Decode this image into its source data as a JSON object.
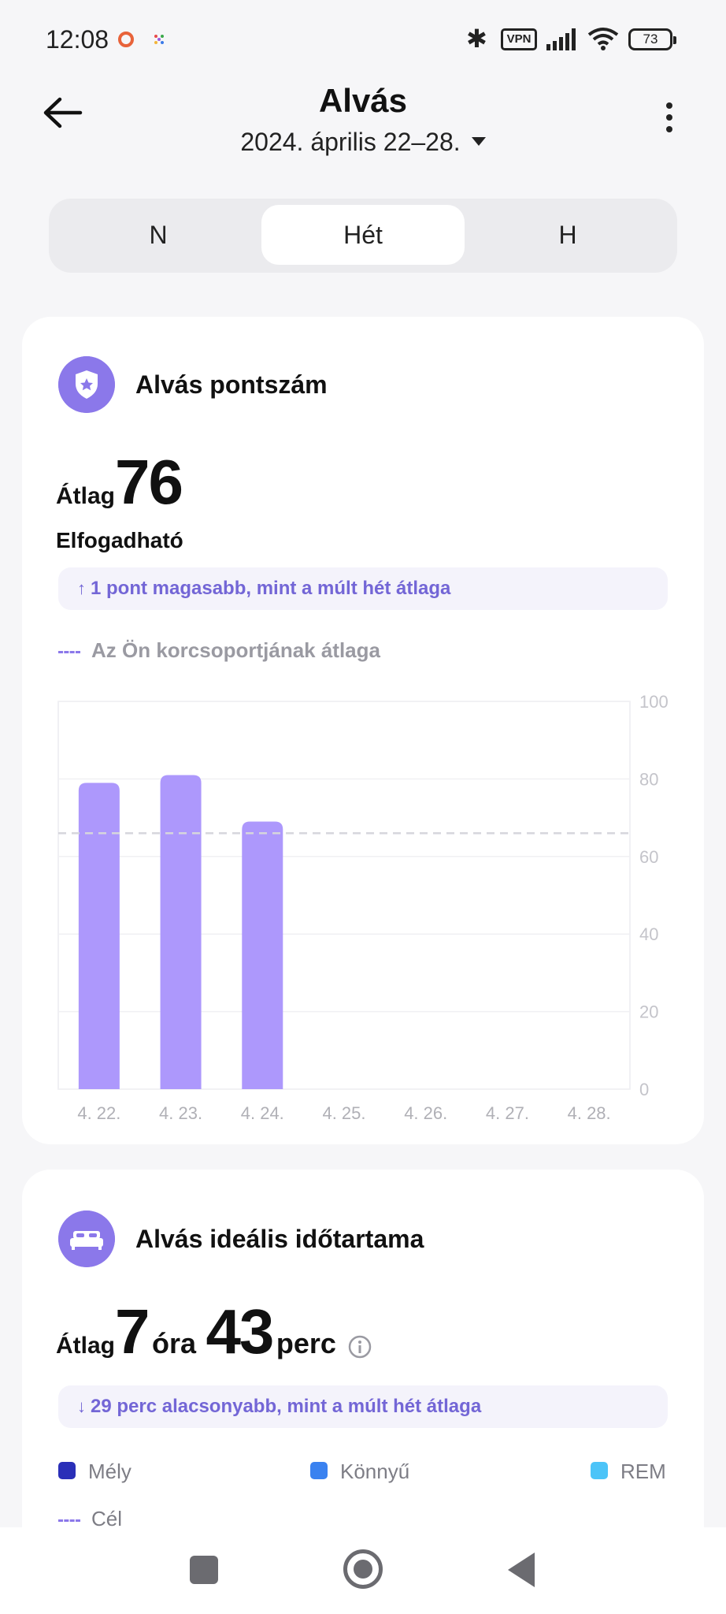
{
  "status_bar": {
    "time": "12:08",
    "vpn_label": "VPN",
    "battery": "73"
  },
  "header": {
    "title": "Alvás",
    "date_range": "2024. április 22–28."
  },
  "tabs": [
    {
      "label": "N",
      "active": false
    },
    {
      "label": "Hét",
      "active": true
    },
    {
      "label": "H",
      "active": false
    }
  ],
  "score_card": {
    "title": "Alvás pontszám",
    "avg_label": "Átlag",
    "avg_value": "76",
    "rating": "Elfogadható",
    "comparison_arrow": "↑",
    "comparison": "1 pont magasabb, mint a múlt hét átlaga",
    "age_group_legend": "Az Ön korcsoportjának átlaga"
  },
  "chart_data": {
    "type": "bar",
    "categories": [
      "4. 22.",
      "4. 23.",
      "4. 24.",
      "4. 25.",
      "4. 26.",
      "4. 27.",
      "4. 28."
    ],
    "values": [
      79,
      81,
      69,
      null,
      null,
      null,
      null
    ],
    "reference_line": 66,
    "ylim": [
      0,
      100
    ],
    "yticks": [
      0,
      20,
      40,
      60,
      80,
      100
    ],
    "y_axis_side": "right",
    "bar_color": "#ad98fc",
    "grid": true
  },
  "duration_card": {
    "title": "Alvás ideális időtartama",
    "avg_label": "Átlag",
    "hours": "7",
    "hours_unit": "óra",
    "minutes": "43",
    "minutes_unit": "perc",
    "comparison_arrow": "↓",
    "comparison": "29 perc alacsonyabb, mint a múlt hét átlaga",
    "legend": [
      {
        "label": "Mély",
        "color": "#2a2fb8"
      },
      {
        "label": "Könnyű",
        "color": "#3a82f0"
      },
      {
        "label": "REM",
        "color": "#4cc4f8"
      }
    ],
    "goal_label": "Cél"
  },
  "colors": {
    "accent": "#8b78ea",
    "pill_text": "#7366d6",
    "background": "#f6f6f8"
  },
  "icons": {
    "back": "arrow-left-icon",
    "more": "more-vertical-icon",
    "score": "shield-star-icon",
    "duration": "bed-icon",
    "info": "info-icon"
  }
}
